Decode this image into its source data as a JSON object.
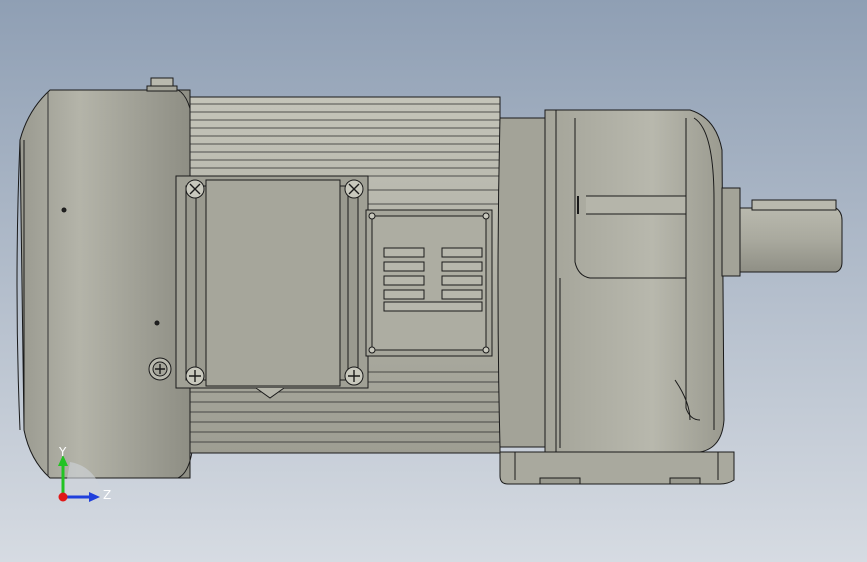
{
  "viewport": {
    "background_top": "#8f9fb4",
    "background_bottom": "#d6dbe2",
    "triad": {
      "y_label": "Y",
      "z_label": "Z",
      "y_color": "#22c322",
      "z_color": "#1f3fdc",
      "x_color": "#e01818",
      "axis_text_color": "#ffffff"
    }
  },
  "model": {
    "body_color": "#a8a89c",
    "edge_color": "#1a1a1a"
  }
}
